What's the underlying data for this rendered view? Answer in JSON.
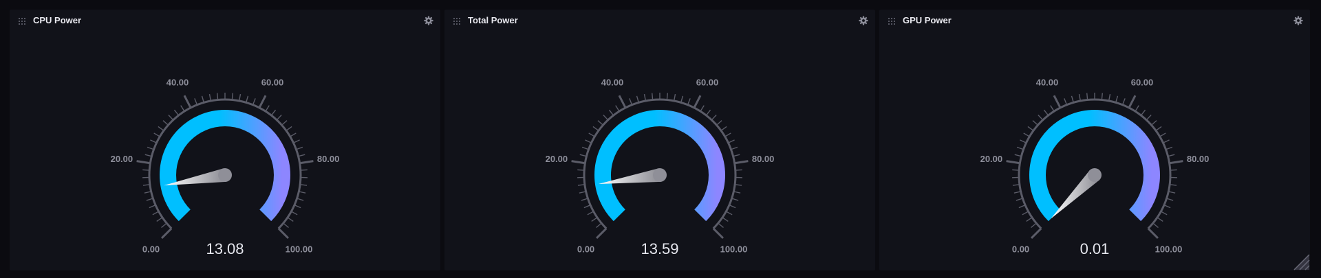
{
  "colors": {
    "page_bg": "#0b0b10",
    "panel_bg": "#111219",
    "arc_start": "#00bfff",
    "arc_end": "#8d86ff",
    "tick": "#5b5c68",
    "label": "#8e8f9b",
    "value": "#e6e7ee"
  },
  "gauge_scale": {
    "min": 0,
    "max": 100,
    "labels": [
      "0.00",
      "20.00",
      "40.00",
      "60.00",
      "80.00",
      "100.00"
    ]
  },
  "panels": [
    {
      "title": "CPU Power",
      "value": 13.08,
      "value_text": "13.08",
      "drag_icon": "drag-grid-icon",
      "settings_icon": "gear-icon"
    },
    {
      "title": "Total Power",
      "value": 13.59,
      "value_text": "13.59",
      "drag_icon": "drag-grid-icon",
      "settings_icon": "gear-icon"
    },
    {
      "title": "GPU Power",
      "value": 0.01,
      "value_text": "0.01",
      "drag_icon": "drag-grid-icon",
      "settings_icon": "gear-icon"
    }
  ]
}
